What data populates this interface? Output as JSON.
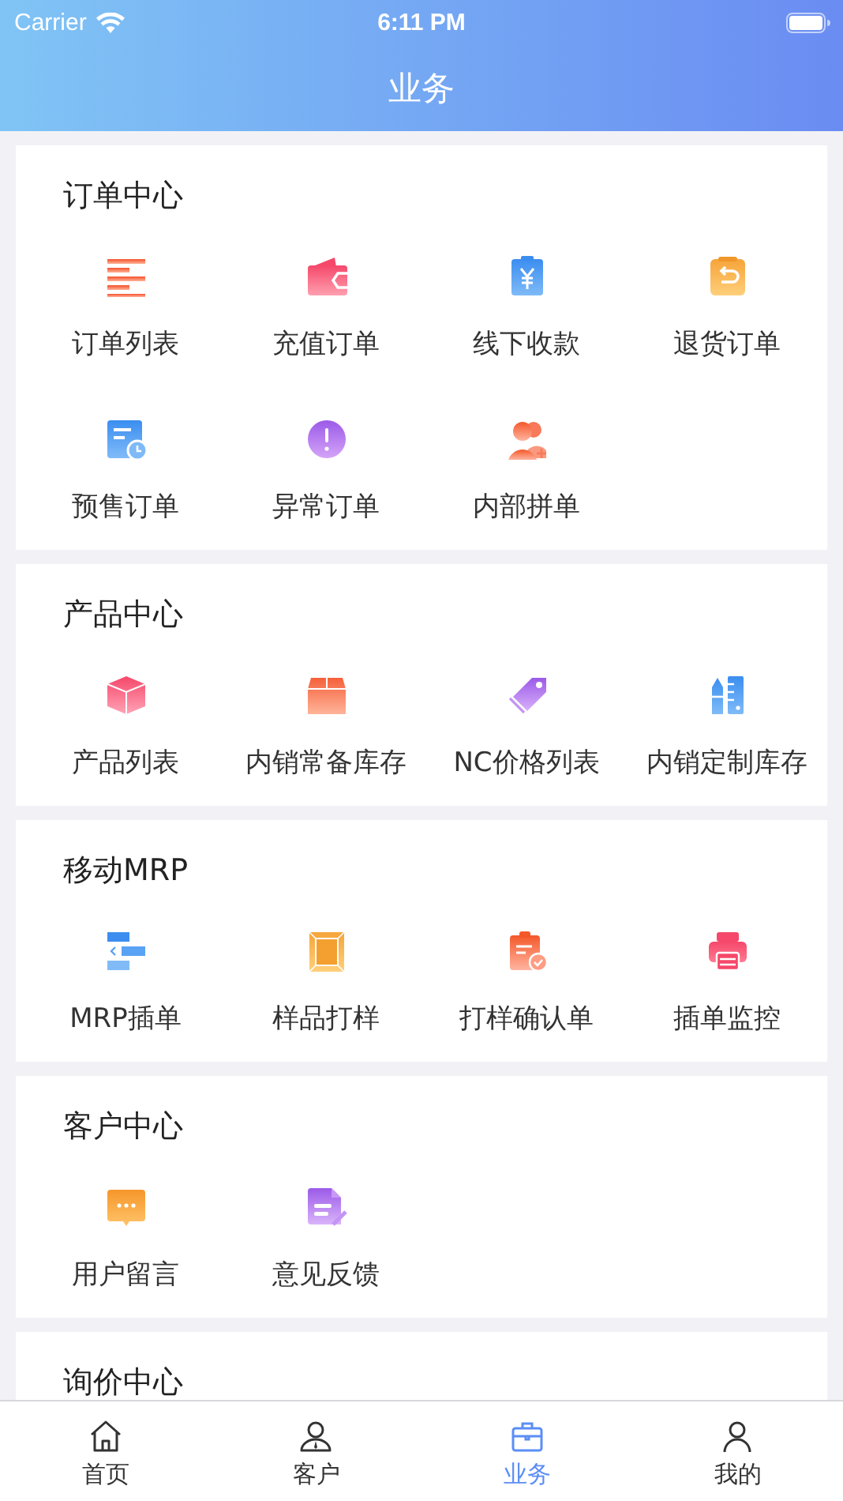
{
  "status_bar": {
    "carrier": "Carrier",
    "time": "6:11 PM"
  },
  "nav_bar": {
    "title": "业务"
  },
  "sections": [
    {
      "title": "订单中心",
      "items": [
        {
          "label": "订单列表"
        },
        {
          "label": "充值订单"
        },
        {
          "label": "线下收款"
        },
        {
          "label": "退货订单"
        },
        {
          "label": "预售订单"
        },
        {
          "label": "异常订单"
        },
        {
          "label": "内部拼单"
        }
      ]
    },
    {
      "title": "产品中心",
      "items": [
        {
          "label": "产品列表"
        },
        {
          "label": "内销常备库存"
        },
        {
          "label": "NC价格列表"
        },
        {
          "label": "内销定制库存"
        }
      ]
    },
    {
      "title": "移动MRP",
      "items": [
        {
          "label": "MRP插单"
        },
        {
          "label": "样品打样"
        },
        {
          "label": "打样确认单"
        },
        {
          "label": "插单监控"
        }
      ]
    },
    {
      "title": "客户中心",
      "items": [
        {
          "label": "用户留言"
        },
        {
          "label": "意见反馈"
        }
      ]
    },
    {
      "title": "询价中心"
    }
  ],
  "tab_bar": [
    {
      "label": "首页",
      "selected": false
    },
    {
      "label": "客户",
      "selected": false
    },
    {
      "label": "业务",
      "selected": true
    },
    {
      "label": "我的",
      "selected": false
    }
  ]
}
